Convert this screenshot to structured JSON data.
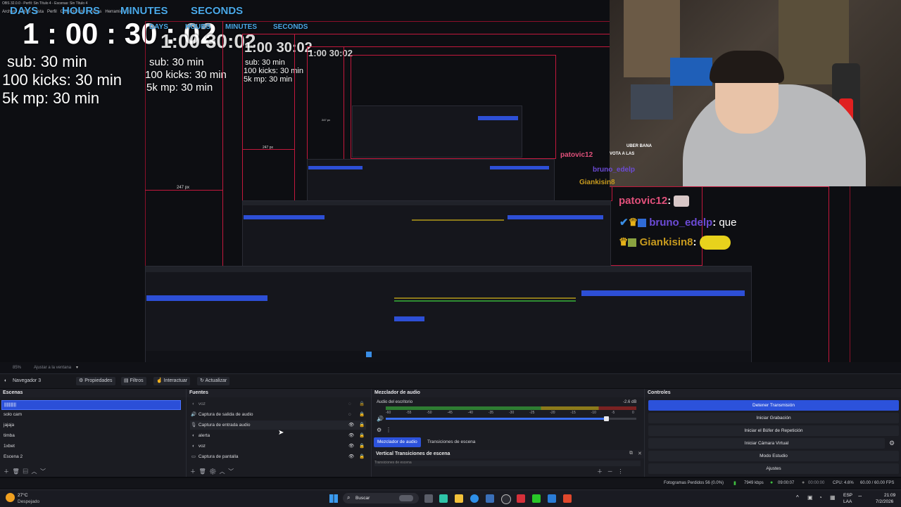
{
  "window": {
    "title": "OBS 32.0.0 - Perfil: Sin Título 4 - Escenas: Sin Título 4",
    "menu": [
      "Archivo",
      "Editar",
      "Vista",
      "Perfil",
      "Colección de escenas",
      "Herramientas"
    ]
  },
  "overlay": {
    "timer_labels": {
      "days": "DAYS",
      "hours": "HOURS",
      "minutes": "MINUTES",
      "seconds": "SECONDS"
    },
    "time": {
      "days": "1",
      "hours": "00",
      "minutes": "30",
      "seconds": "02"
    },
    "goals": [
      "sub: 30 min",
      "100 kicks: 30 min",
      "5k mp: 30 min"
    ]
  },
  "recursive_preview": {
    "dimension_labels": [
      "247 px",
      "247 px",
      "247 px"
    ]
  },
  "chat": [
    {
      "user": "patovic12",
      "text": "",
      "color": "#e0507a"
    },
    {
      "user": "bruno_edelp",
      "text": "que",
      "color": "#6c4bd6"
    },
    {
      "user": "Giankisin8",
      "text": "",
      "color": "#c79a1e"
    }
  ],
  "chat_small": [
    "UBER BANA",
    "VOTA A LAS"
  ],
  "status_top": {
    "zoom": "85%",
    "fit": "Ajustar a la ventana"
  },
  "toolbar": {
    "scene_name": "Navegador 3",
    "properties": "Propiedades",
    "filters": "Filtros",
    "interact": "Interactuar",
    "refresh": "Actualizar"
  },
  "scenes": {
    "title": "Escenas",
    "items": [
      "||||||||||",
      "solo cam",
      "jajaja",
      "timba",
      "1xbet",
      "Escena 2"
    ]
  },
  "sources": {
    "title": "Fuentes",
    "items": [
      "voz",
      "Captura de salida de audio",
      "Captura de entrada audio",
      "alerta",
      "voz",
      "Captura de pantalla"
    ]
  },
  "mixer": {
    "title": "Mezclador de audio",
    "channel": "Audio del escritorio",
    "db": "-2.6 dB",
    "scale": [
      "-60",
      "-55",
      "-50",
      "-45",
      "-40",
      "-35",
      "-30",
      "-25",
      "-20",
      "-15",
      "-10",
      "-5",
      "0"
    ],
    "tab_mixer": "Mezclador de audio",
    "tab_transitions": "Transiciones de escena",
    "vertical_title": "Vertical Transiciones de escena",
    "vertical_sub": "Transiciones de escena",
    "volume": 0.88
  },
  "controls": {
    "title": "Controles",
    "buttons": [
      "Detener Transmisión",
      "Iniciar Grabación",
      "Iniciar el Búfer de Repetición",
      "Iniciar Cámara Virtual",
      "Modo Estudio",
      "Ajustes"
    ]
  },
  "obs_status": {
    "dropped": "Fotogramas Perdidos 56 (0.0%)",
    "kbps": "7949 kbps",
    "stream_time": "09:00:07",
    "rec_time": "00:00:00",
    "cpu": "CPU: 4.6%",
    "fps": "60.00 / 60.00 FPS"
  },
  "taskbar": {
    "weather_temp": "27°C",
    "weather_desc": "Despejado",
    "search": "Buscar",
    "lang1": "ESP",
    "lang2": "LAA",
    "time": "21:09",
    "date": "7/2/2026"
  },
  "colors": {
    "accent": "#2c52db",
    "record_border": "#c2183c",
    "timer_blue": "#4aa8e8"
  }
}
